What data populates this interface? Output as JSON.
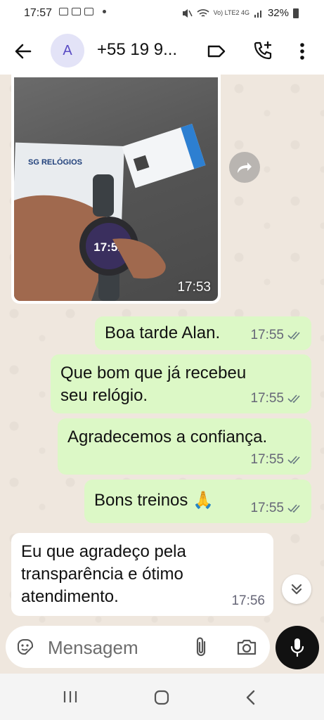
{
  "status_bar": {
    "time": "17:57",
    "network": "Vo) LTE2 4G",
    "battery": "32%"
  },
  "header": {
    "avatar_letter": "A",
    "contact_name": "+55 19 9..."
  },
  "photo_message": {
    "time": "17:53",
    "watch_face_time": "17:51",
    "box_text": "SG RELÓGIOS"
  },
  "messages": [
    {
      "text": "Boa tarde Alan.",
      "time": "17:55",
      "direction": "out"
    },
    {
      "text": "Que bom que já recebeu\nseu relógio.",
      "time": "17:55",
      "direction": "out"
    },
    {
      "text": "Agradecemos a confiança.",
      "time": "17:55",
      "direction": "out"
    },
    {
      "text": "Bons treinos 🙏",
      "time": "17:55",
      "direction": "out"
    },
    {
      "text": "Eu que agradeço pela\ntransparência e ótimo\natendimento.",
      "time": "17:56",
      "direction": "in"
    }
  ],
  "composer": {
    "placeholder": "Mensagem"
  },
  "colors": {
    "outgoing_bubble": "#dcf8c6",
    "incoming_bubble": "#ffffff",
    "read_ticks": "#667781",
    "mic_button": "#111111"
  }
}
